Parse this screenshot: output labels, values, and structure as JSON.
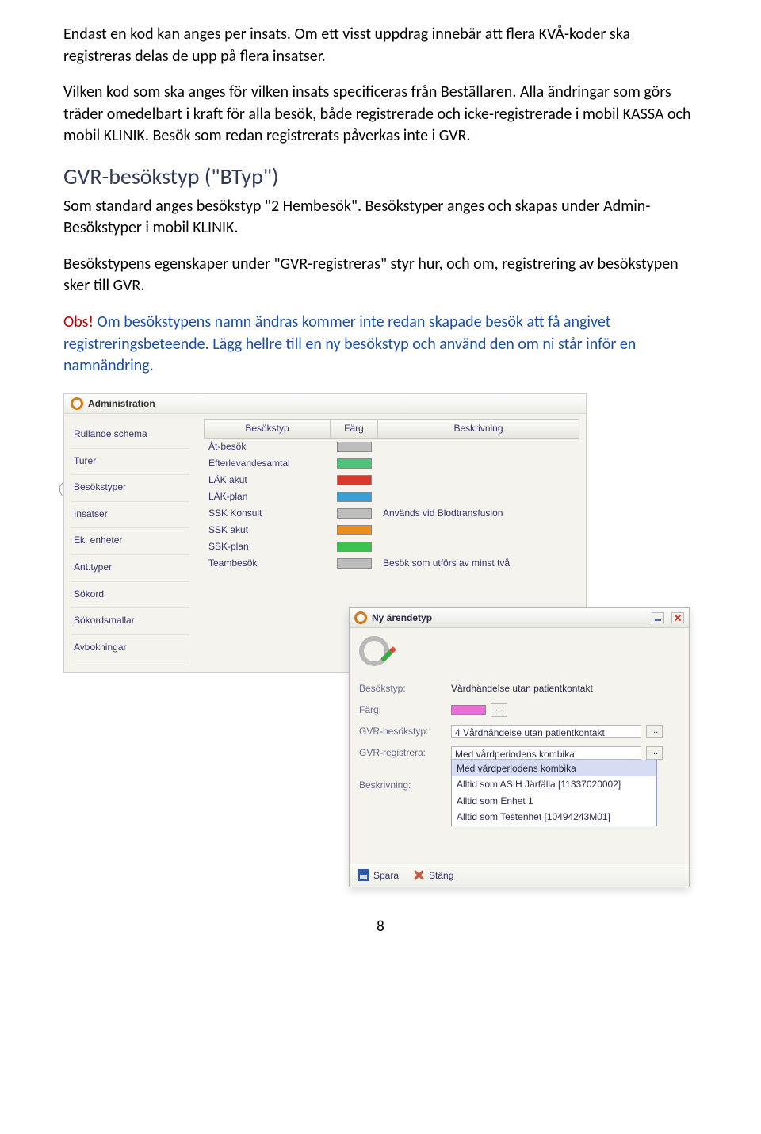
{
  "text": {
    "p1": "Endast en kod kan anges per insats. Om ett visst uppdrag innebär att flera KVÅ-koder ska registreras delas de upp på flera insatser.",
    "p2": "Vilken kod som ska anges för vilken insats specificeras från Beställaren. Alla ändringar som görs träder omedelbart i kraft för alla besök, både registrerade och icke-registrerade i mobil KASSA och mobil KLINIK. Besök som redan registrerats påverkas inte i GVR.",
    "h1": "GVR-besökstyp (\"BTyp\")",
    "p3": "Som standard anges besökstyp \"2 Hembesök\". Besökstyper anges och skapas under Admin- Besökstyper i mobil KLINIK.",
    "p4": "Besökstypens egenskaper under \"GVR-registreras\" styr hur, och om, registrering av besökstypen sker till GVR.",
    "obs": "Obs!",
    "p5": " Om besökstypens namn ändras kommer inte redan skapade besök att få angivet registreringsbeteende. Lägg hellre till en ny besökstyp och använd den om ni står inför en namnändring.",
    "page": "8"
  },
  "admin": {
    "title": "Administration",
    "sidebar": [
      "Rullande schema",
      "Turer",
      "Besökstyper",
      "Insatser",
      "Ek. enheter",
      "Ant.typer",
      "Sökord",
      "Sökordsmallar",
      "Avbokningar"
    ],
    "selectedIndex": 2,
    "columns": [
      "Besökstyp",
      "Färg",
      "Beskrivning"
    ],
    "rows": [
      {
        "name": "Åt-besök",
        "color": "#bdbdbd",
        "desc": ""
      },
      {
        "name": "Efterlevandesamtal",
        "color": "#4cc47a",
        "desc": ""
      },
      {
        "name": "LÄK akut",
        "color": "#d63a2e",
        "desc": ""
      },
      {
        "name": "LÄK-plan",
        "color": "#3a9fd6",
        "desc": ""
      },
      {
        "name": "SSK Konsult",
        "color": "#bdbdbd",
        "desc": "Används vid Blodtransfusion"
      },
      {
        "name": "SSK akut",
        "color": "#e98e1e",
        "desc": ""
      },
      {
        "name": "SSK-plan",
        "color": "#3ac24d",
        "desc": ""
      },
      {
        "name": "Teambesök",
        "color": "#bdbdbd",
        "desc": "Besök som utförs av minst två"
      }
    ]
  },
  "dialog": {
    "title": "Ny ärendetyp",
    "labels": {
      "besokstyp": "Besökstyp:",
      "farg": "Färg:",
      "gvrbesokstyp": "GVR-besökstyp:",
      "gvrregistrera": "GVR-registrera:",
      "beskrivning": "Beskrivning:"
    },
    "values": {
      "besokstyp": "Vårdhändelse utan patientkontakt",
      "farg": "#e86fd6",
      "gvrbesokstyp": "4 Vårdhändelse utan patientkontakt",
      "gvrregistrera_selected": "Med vårdperiodens kombika"
    },
    "options": [
      "Med vårdperiodens kombika",
      "Alltid som ASIH Järfälla [11337020002]",
      "Alltid som Enhet 1",
      "Alltid som Testenhet [10494243M01]"
    ],
    "actions": {
      "save": "Spara",
      "close": "Stäng"
    },
    "dots": "..."
  }
}
